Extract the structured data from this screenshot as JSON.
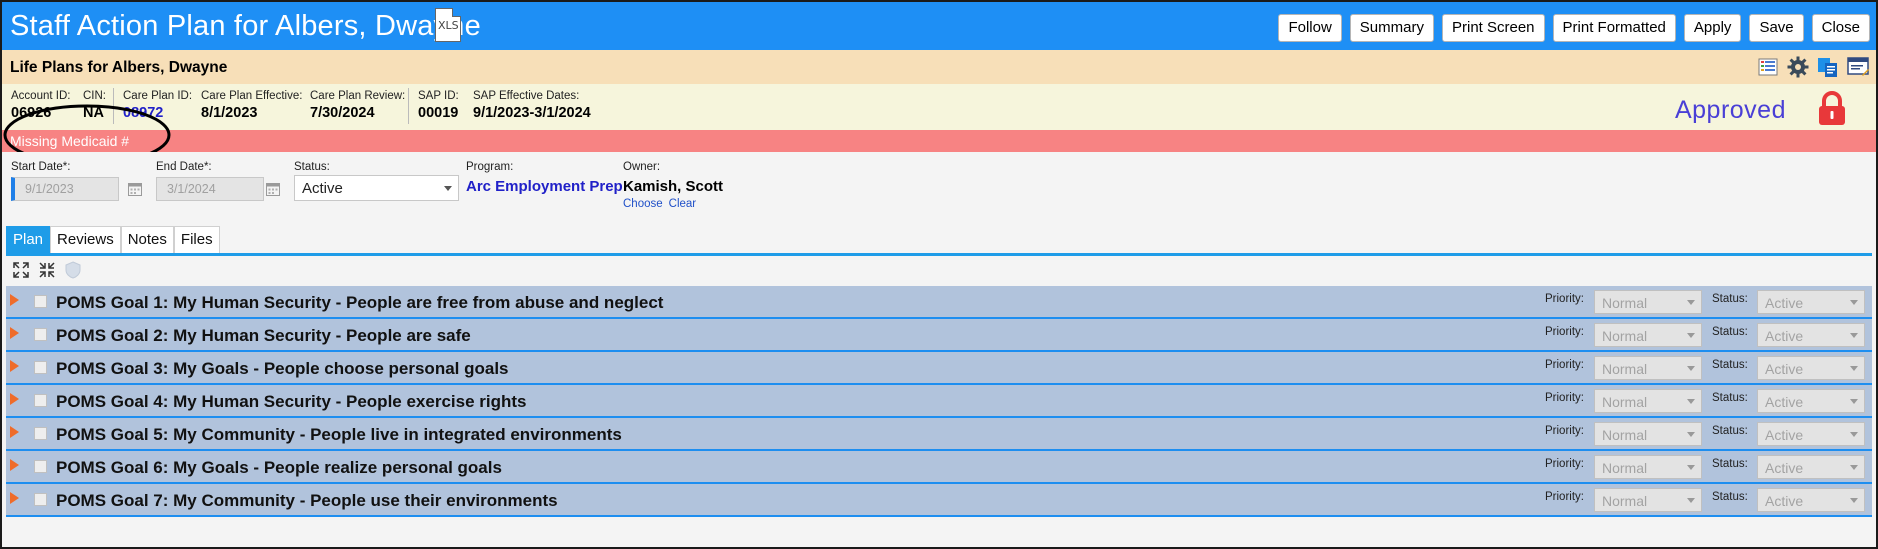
{
  "window": {
    "title": "Staff Action Plan for Albers, Dwayne",
    "xls_icon_text": "XLS",
    "buttons": {
      "follow": "Follow",
      "summary": "Summary",
      "print_screen": "Print Screen",
      "print_formatted": "Print Formatted",
      "apply": "Apply",
      "save": "Save",
      "close": "Close"
    }
  },
  "subheader": {
    "title": "Life Plans for Albers, Dwayne",
    "icons": [
      "grid-list-icon",
      "gear-icon",
      "copy-documents-icon",
      "notes-window-icon"
    ]
  },
  "info": {
    "account_id": {
      "label": "Account ID:",
      "value": "06926"
    },
    "cin": {
      "label": "CIN:",
      "value": "NA"
    },
    "care_plan_id": {
      "label": "Care Plan ID:",
      "value": "08972"
    },
    "care_plan_effective": {
      "label": "Care Plan Effective:",
      "value": "8/1/2023"
    },
    "care_plan_review": {
      "label": "Care Plan Review:",
      "value": "7/30/2024"
    },
    "sap_id": {
      "label": "SAP ID:",
      "value": "00019"
    },
    "sap_effective_dates": {
      "label": "SAP Effective Dates:",
      "value": "9/1/2023-3/1/2024"
    },
    "status_text": "Approved",
    "status_icon": "lock-icon"
  },
  "alert": {
    "text": "Missing Medicaid #"
  },
  "form": {
    "start_date": {
      "label": "Start Date*:",
      "value": "9/1/2023"
    },
    "end_date": {
      "label": "End Date*:",
      "value": "3/1/2024"
    },
    "status": {
      "label": "Status:",
      "value": "Active"
    },
    "program": {
      "label": "Program:",
      "value": "Arc Employment Prep"
    },
    "owner": {
      "label": "Owner:",
      "value": "Kamish, Scott",
      "choose": "Choose",
      "clear": "Clear"
    }
  },
  "tabs": [
    {
      "label": "Plan",
      "active": true
    },
    {
      "label": "Reviews",
      "active": false
    },
    {
      "label": "Notes",
      "active": false
    },
    {
      "label": "Files",
      "active": false
    }
  ],
  "goal_field_labels": {
    "priority": "Priority:",
    "status": "Status:"
  },
  "goals": [
    {
      "prefix": "POMS Goal 1",
      "title": ": My Human Security - People are free from abuse and neglect",
      "priority": "Normal",
      "status": "Active"
    },
    {
      "prefix": "POMS Goal 2",
      "title": ": My Human Security - People are safe",
      "priority": "Normal",
      "status": "Active"
    },
    {
      "prefix": "POMS Goal 3",
      "title": ": My Goals - People choose personal goals",
      "priority": "Normal",
      "status": "Active"
    },
    {
      "prefix": "POMS Goal 4",
      "title": ": My Human Security - People exercise rights",
      "priority": "Normal",
      "status": "Active"
    },
    {
      "prefix": "POMS Goal 5",
      "title": ": My Community - People live in integrated environments",
      "priority": "Normal",
      "status": "Active"
    },
    {
      "prefix": "POMS Goal 6",
      "title": ": My Goals - People realize personal goals",
      "priority": "Normal",
      "status": "Active"
    },
    {
      "prefix": "POMS Goal 7",
      "title": ": My Community - People use their environments",
      "priority": "Normal",
      "status": "Active"
    }
  ],
  "colors": {
    "title_bar": "#1e8ff5",
    "subheader": "#f7dfb8",
    "info_bar": "#f6f5dc",
    "alert": "#f78383",
    "goal_row": "#b1c3dc",
    "approved_text": "#4a3fd6",
    "lock": "#e8383a",
    "tab_active": "#1e9ce8",
    "expander_arrow": "#ef6c2a"
  }
}
